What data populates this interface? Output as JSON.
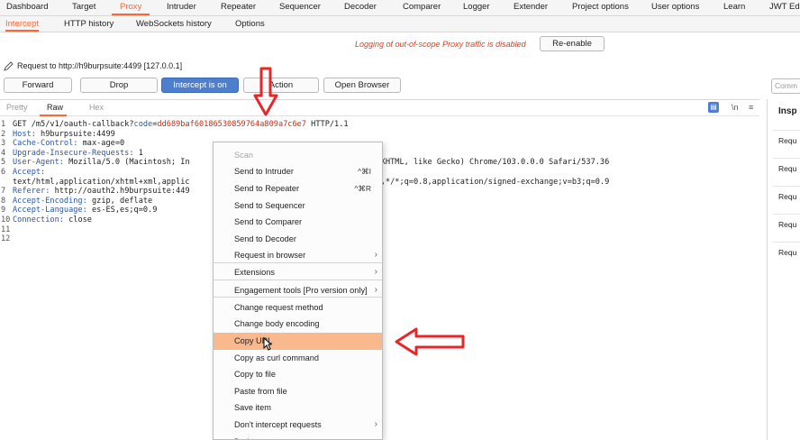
{
  "top_tabs": [
    "Dashboard",
    "Target",
    "Proxy",
    "Intruder",
    "Repeater",
    "Sequencer",
    "Decoder",
    "Comparer",
    "Logger",
    "Extender",
    "Project options",
    "User options",
    "Learn",
    "JWT Ed"
  ],
  "sub_tabs": [
    "Intercept",
    "HTTP history",
    "WebSockets history",
    "Options"
  ],
  "notice": {
    "text": "Logging of out-of-scope Proxy traffic is disabled",
    "button": "Re-enable"
  },
  "request_label": "Request to http://h9burpsuite:4499  [127.0.0.1]",
  "toolbar": {
    "forward": "Forward",
    "drop": "Drop",
    "intercept": "Intercept is on",
    "action": "Action",
    "open_browser": "Open Browser",
    "comment_placeholder": "Comm"
  },
  "editor_tabs": {
    "pretty": "Pretty",
    "raw": "Raw",
    "hex": "Hex",
    "newline_icon": "\\n",
    "menu_icon": "≡"
  },
  "code_lines": [
    {
      "n": "1",
      "segs": [
        {
          "t": "GET /m5/v1/oauth-callback?",
          "c": ""
        },
        {
          "t": "code",
          "c": "k"
        },
        {
          "t": "=",
          "c": ""
        },
        {
          "t": "dd689baf60186530859764a809a7c6e7",
          "c": "v"
        },
        {
          "t": " HTTP/1.1",
          "c": ""
        }
      ]
    },
    {
      "n": "2",
      "segs": [
        {
          "t": "Host:",
          "c": "k"
        },
        {
          "t": " h9burpsuite:4499",
          "c": ""
        }
      ]
    },
    {
      "n": "3",
      "segs": [
        {
          "t": "Cache-Control:",
          "c": "k"
        },
        {
          "t": " max-age=0",
          "c": ""
        }
      ]
    },
    {
      "n": "4",
      "segs": [
        {
          "t": "Upgrade-Insecure-Requests:",
          "c": "k"
        },
        {
          "t": " 1",
          "c": ""
        }
      ]
    },
    {
      "n": "5",
      "segs": [
        {
          "t": "User-Agent:",
          "c": "k"
        },
        {
          "t": " Mozilla/5.0 (Macintosh; In",
          "c": ""
        },
        {
          "t": "                               ",
          "c": ""
        },
        {
          "t": "t/537.36 (KHTML, like Gecko) Chrome/103.0.0.0 Safari/537.36",
          "c": ""
        }
      ]
    },
    {
      "n": "6",
      "segs": [
        {
          "t": "Accept:",
          "c": "k"
        }
      ]
    },
    {
      "n": "",
      "segs": [
        {
          "t": "text/html,application/xhtml+xml,applic",
          "c": ""
        },
        {
          "t": "                         ",
          "c": ""
        },
        {
          "t": "/webp,image/apng,*/*;q=0.8,application/signed-exchange;v=b3;q=0.9",
          "c": ""
        }
      ]
    },
    {
      "n": "7",
      "segs": [
        {
          "t": "Referer:",
          "c": "k"
        },
        {
          "t": " http://oauth2.h9burpsuite:449",
          "c": ""
        }
      ]
    },
    {
      "n": "8",
      "segs": [
        {
          "t": "Accept-Encoding:",
          "c": "k"
        },
        {
          "t": " gzip, deflate",
          "c": ""
        }
      ]
    },
    {
      "n": "9",
      "segs": [
        {
          "t": "Accept-Language:",
          "c": "k"
        },
        {
          "t": " es-ES,es;q=0.9",
          "c": ""
        }
      ]
    },
    {
      "n": "10",
      "segs": [
        {
          "t": "Connection:",
          "c": "k"
        },
        {
          "t": " close",
          "c": ""
        }
      ]
    },
    {
      "n": "11",
      "segs": []
    },
    {
      "n": "12",
      "segs": []
    }
  ],
  "inspector": {
    "title": "Insp",
    "items": [
      "Requ",
      "Requ",
      "Requ",
      "Requ",
      "Requ"
    ]
  },
  "context_menu": {
    "items": [
      {
        "label": "Scan",
        "disabled": true
      },
      {
        "label": "Send to Intruder",
        "shortcut": "^⌘I"
      },
      {
        "label": "Send to Repeater",
        "shortcut": "^⌘R"
      },
      {
        "label": "Send to Sequencer"
      },
      {
        "label": "Send to Comparer"
      },
      {
        "label": "Send to Decoder"
      },
      {
        "label": "Request in browser",
        "submenu": true
      },
      {
        "label": "Extensions",
        "submenu": true
      },
      {
        "label": "Engagement tools [Pro version only]",
        "submenu": true
      },
      {
        "label": "Change request method"
      },
      {
        "label": "Change body encoding"
      },
      {
        "label": "Copy URL",
        "highlight": true
      },
      {
        "label": "Copy as curl command"
      },
      {
        "label": "Copy to file"
      },
      {
        "label": "Paste from file"
      },
      {
        "label": "Save item"
      },
      {
        "label": "Don't intercept requests",
        "submenu": true
      },
      {
        "label": "Do intercept",
        "submenu": true
      }
    ]
  },
  "colors": {
    "accent": "#ff6633",
    "primary_button": "#4e7fcf",
    "annotation": "#e8262a",
    "menu_highlight": "#f9b98d"
  }
}
